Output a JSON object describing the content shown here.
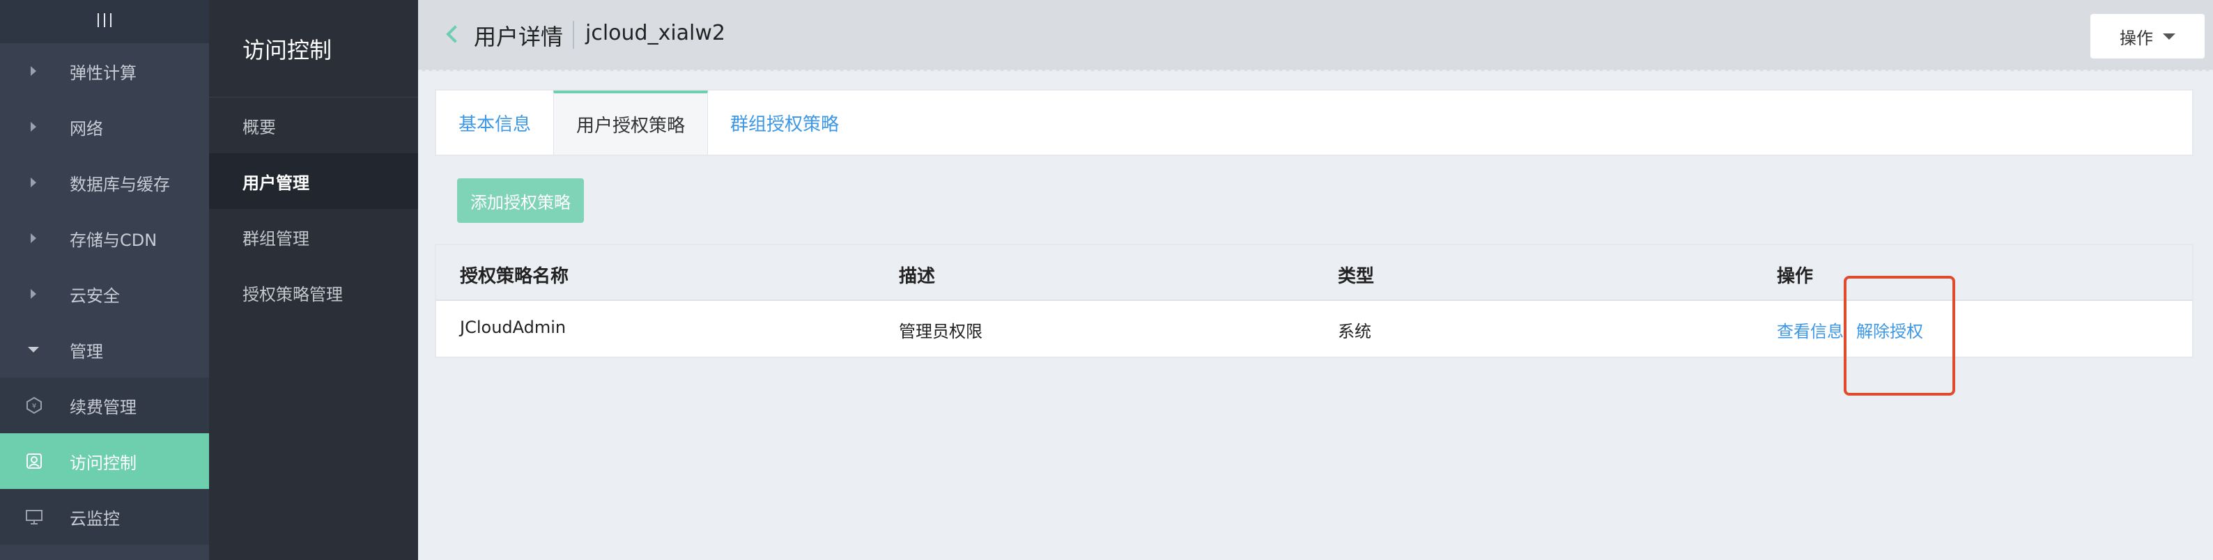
{
  "leftnav": {
    "toggle_icon": "menu-icon",
    "items": [
      {
        "label": "弹性计算",
        "icon": "chevron-right-icon"
      },
      {
        "label": "网络",
        "icon": "chevron-right-icon"
      },
      {
        "label": "数据库与缓存",
        "icon": "chevron-right-icon"
      },
      {
        "label": "存储与CDN",
        "icon": "chevron-right-icon"
      },
      {
        "label": "云安全",
        "icon": "chevron-right-icon"
      },
      {
        "label": "管理",
        "icon": "chevron-down-icon"
      },
      {
        "label": "续费管理",
        "icon": "renew-icon"
      },
      {
        "label": "访问控制",
        "icon": "access-control-icon",
        "active": true
      },
      {
        "label": "云监控",
        "icon": "monitor-icon"
      }
    ]
  },
  "subnav": {
    "title": "访问控制",
    "items": [
      {
        "label": "概要"
      },
      {
        "label": "用户管理",
        "active": true
      },
      {
        "label": "群组管理"
      },
      {
        "label": "授权策略管理"
      }
    ]
  },
  "header": {
    "title": "用户详情",
    "username": "jcloud_xialw2",
    "ops_label": "操作"
  },
  "tabs": [
    {
      "label": "基本信息"
    },
    {
      "label": "用户授权策略",
      "active": true
    },
    {
      "label": "群组授权策略"
    }
  ],
  "add_button": "添加授权策略",
  "table": {
    "headers": [
      "授权策略名称",
      "描述",
      "类型",
      "操作"
    ],
    "rows": [
      {
        "name": "JCloudAdmin",
        "desc": "管理员权限",
        "type": "系统",
        "view": "查看信息",
        "revoke": "解除授权"
      }
    ]
  },
  "colors": {
    "accent": "#6dcfae",
    "link": "#3c97e6",
    "highlight": "#e04a2d"
  }
}
